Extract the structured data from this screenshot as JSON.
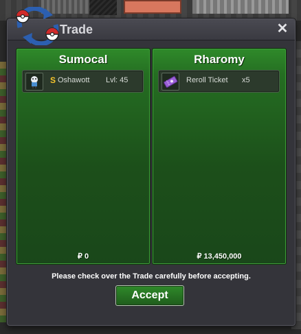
{
  "window": {
    "title": "Trade",
    "close_icon": "close-icon",
    "logo_icon": "trade-arrows-pokeball-icon"
  },
  "left_panel": {
    "player_name": "Sumocal",
    "items": [
      {
        "icon": "oshawott-sprite-icon",
        "coin_icon": "gold-s-coin-icon",
        "coin_glyph": "S",
        "name": "Oshawott",
        "detail": "Lvl: 45"
      }
    ],
    "money": "₽ 0"
  },
  "right_panel": {
    "player_name": "Rharomy",
    "items": [
      {
        "icon": "reroll-ticket-icon",
        "name": "Reroll Ticket",
        "detail": "x5"
      }
    ],
    "money": "₽ 13,450,000"
  },
  "notice": "Please check over the Trade carefully before accepting.",
  "accept_label": "Accept",
  "colors": {
    "panel_green": "#256e22",
    "window_bg": "#34343a",
    "coin_gold": "#f6c52b"
  }
}
